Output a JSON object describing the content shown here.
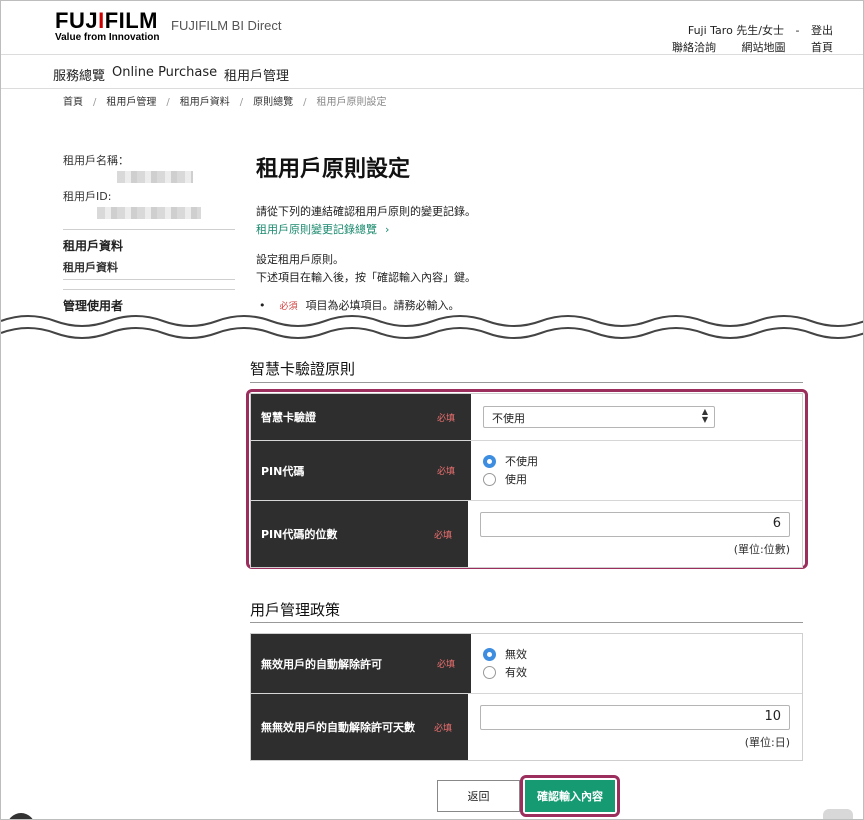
{
  "header": {
    "logo_left": "FUJ",
    "logo_i": "I",
    "logo_right": "FILM",
    "logo_tagline": "Value from Innovation",
    "brand": "FUJIFILM BI Direct",
    "user_name": "Fuji Taro 先生/女士",
    "user_sep": "-",
    "logout": "登出",
    "contact": "聯絡洽詢",
    "sitemap": "網站地圖",
    "home": "首頁"
  },
  "nav": {
    "items": [
      "服務總覽",
      "Online Purchase",
      "租用戶管理"
    ]
  },
  "breadcrumb": {
    "items": [
      "首頁",
      "租用戶管理",
      "租用戶資料",
      "原則總覽"
    ],
    "current": "租用戶原則設定",
    "separator": "/"
  },
  "sidebar": {
    "tenant_name_label": "租用戶名稱：",
    "tenant_id_label": "租用戶ID:",
    "section1_head": "租用戶資料",
    "section1_item": "租用戶資料",
    "section2_head": "管理使用者"
  },
  "main": {
    "title": "租用戶原則設定",
    "intro": "請從下列的連結確認租用戶原則的變更記錄。",
    "history_link": "租用戶原則變更記錄總覽",
    "history_link_icon": "chevron-right-icon",
    "desc1": "設定租用戶原則。",
    "desc2": "下述項目在輸入後，按「確認輸入內容」鍵。",
    "required_tag": "必須",
    "required_note": "項目為必填項目。請務必輸入。"
  },
  "smartcard": {
    "title": "智慧卡驗證原則",
    "rows": [
      {
        "label": "智慧卡驗證",
        "required": "必填",
        "select_value": "不使用"
      },
      {
        "label": "PIN代碼",
        "required": "必填",
        "options": [
          "不使用",
          "使用"
        ],
        "selected": 0
      },
      {
        "label": "PIN代碼的位數",
        "required": "必填",
        "value": "6",
        "unit": "(單位:位數)"
      }
    ]
  },
  "user_policy": {
    "title": "用戶管理政策",
    "rows": [
      {
        "label": "無效用戶的自動解除許可",
        "required": "必填",
        "options": [
          "無效",
          "有效"
        ],
        "selected": 0
      },
      {
        "label": "無無效用戶的自動解除許可天數",
        "required": "必填",
        "value": "10",
        "unit": "(單位:日)"
      }
    ]
  },
  "buttons": {
    "back": "返回",
    "confirm": "確認輸入內容"
  },
  "colors": {
    "accent_green": "#159a72",
    "link_green": "#1a8a6e",
    "highlight": "#9c2e5d",
    "required_red": "#d23b3b",
    "label_bg": "#2e2e2e",
    "radio_blue": "#3d8de0"
  }
}
